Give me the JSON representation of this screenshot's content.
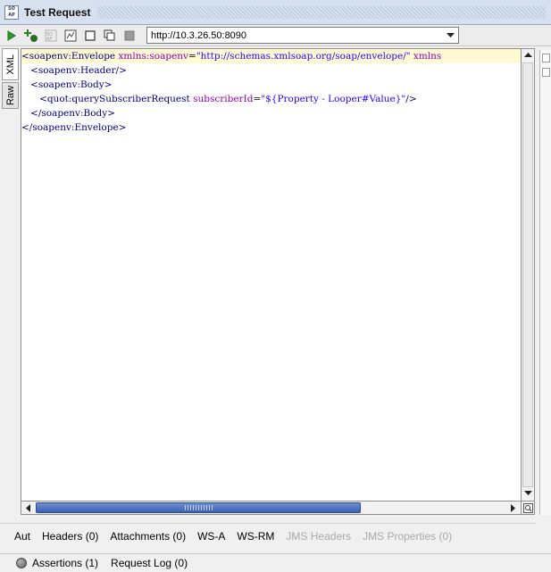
{
  "window": {
    "title": "Test Request",
    "app_icon_text": "SO AP"
  },
  "toolbar": {
    "buttons": [
      {
        "icon": "run-icon",
        "color": "#2e9b2e"
      },
      {
        "icon": "add-step-icon"
      },
      {
        "icon": "soap-disabled-icon"
      },
      {
        "icon": "wsdl-icon"
      },
      {
        "icon": "square-icon"
      },
      {
        "icon": "clone-icon"
      },
      {
        "icon": "stop-icon"
      }
    ],
    "endpoint_value": "http://10.3.26.50:8090"
  },
  "side_tabs": [
    {
      "label": "XML",
      "active": true
    },
    {
      "label": "Raw",
      "active": false
    }
  ],
  "editor": {
    "lines": [
      {
        "indent": "",
        "tokens": [
          {
            "t": "<soapenv:Envelope",
            "c": "tag"
          },
          {
            "t": " xmlns:soapenv",
            "c": "attr"
          },
          {
            "t": "=",
            "c": "plain"
          },
          {
            "t": "\"http://schemas.xmlsoap.org/soap/envelope/\"",
            "c": "str"
          },
          {
            "t": " xmlns",
            "c": "attr"
          }
        ]
      },
      {
        "indent": "   ",
        "tokens": [
          {
            "t": "<soapenv:Header/>",
            "c": "tag"
          }
        ]
      },
      {
        "indent": "   ",
        "tokens": [
          {
            "t": "<soapenv:Body>",
            "c": "tag"
          }
        ]
      },
      {
        "indent": "      ",
        "tokens": [
          {
            "t": "<quot:querySubscriberRequest",
            "c": "tag"
          },
          {
            "t": " subscriberId",
            "c": "attr"
          },
          {
            "t": "=",
            "c": "plain"
          },
          {
            "t": "\"${Property - Looper#Value}\"",
            "c": "str"
          },
          {
            "t": "/>",
            "c": "tag"
          }
        ]
      },
      {
        "indent": "   ",
        "tokens": [
          {
            "t": "</soapenv:Body>",
            "c": "tag"
          }
        ]
      },
      {
        "indent": "",
        "tokens": [
          {
            "t": "</soapenv:Envelope>",
            "c": "tag"
          }
        ]
      }
    ]
  },
  "request_tabs": [
    {
      "label": "Aut",
      "enabled": true
    },
    {
      "label": "Headers (0)",
      "enabled": true
    },
    {
      "label": "Attachments (0)",
      "enabled": true
    },
    {
      "label": "WS-A",
      "enabled": true
    },
    {
      "label": "WS-RM",
      "enabled": true
    },
    {
      "label": "JMS Headers",
      "enabled": false
    },
    {
      "label": "JMS Properties (0)",
      "enabled": false
    }
  ],
  "bottom_tabs": [
    {
      "label": "Assertions (1)"
    },
    {
      "label": "Request Log (0)"
    }
  ],
  "colors": {
    "xml_tag": "#000080",
    "xml_attr": "#8f00b5",
    "xml_string": "#2a00ff",
    "current_line": "#fffad2",
    "scroll_thumb": "#3d61b4"
  }
}
